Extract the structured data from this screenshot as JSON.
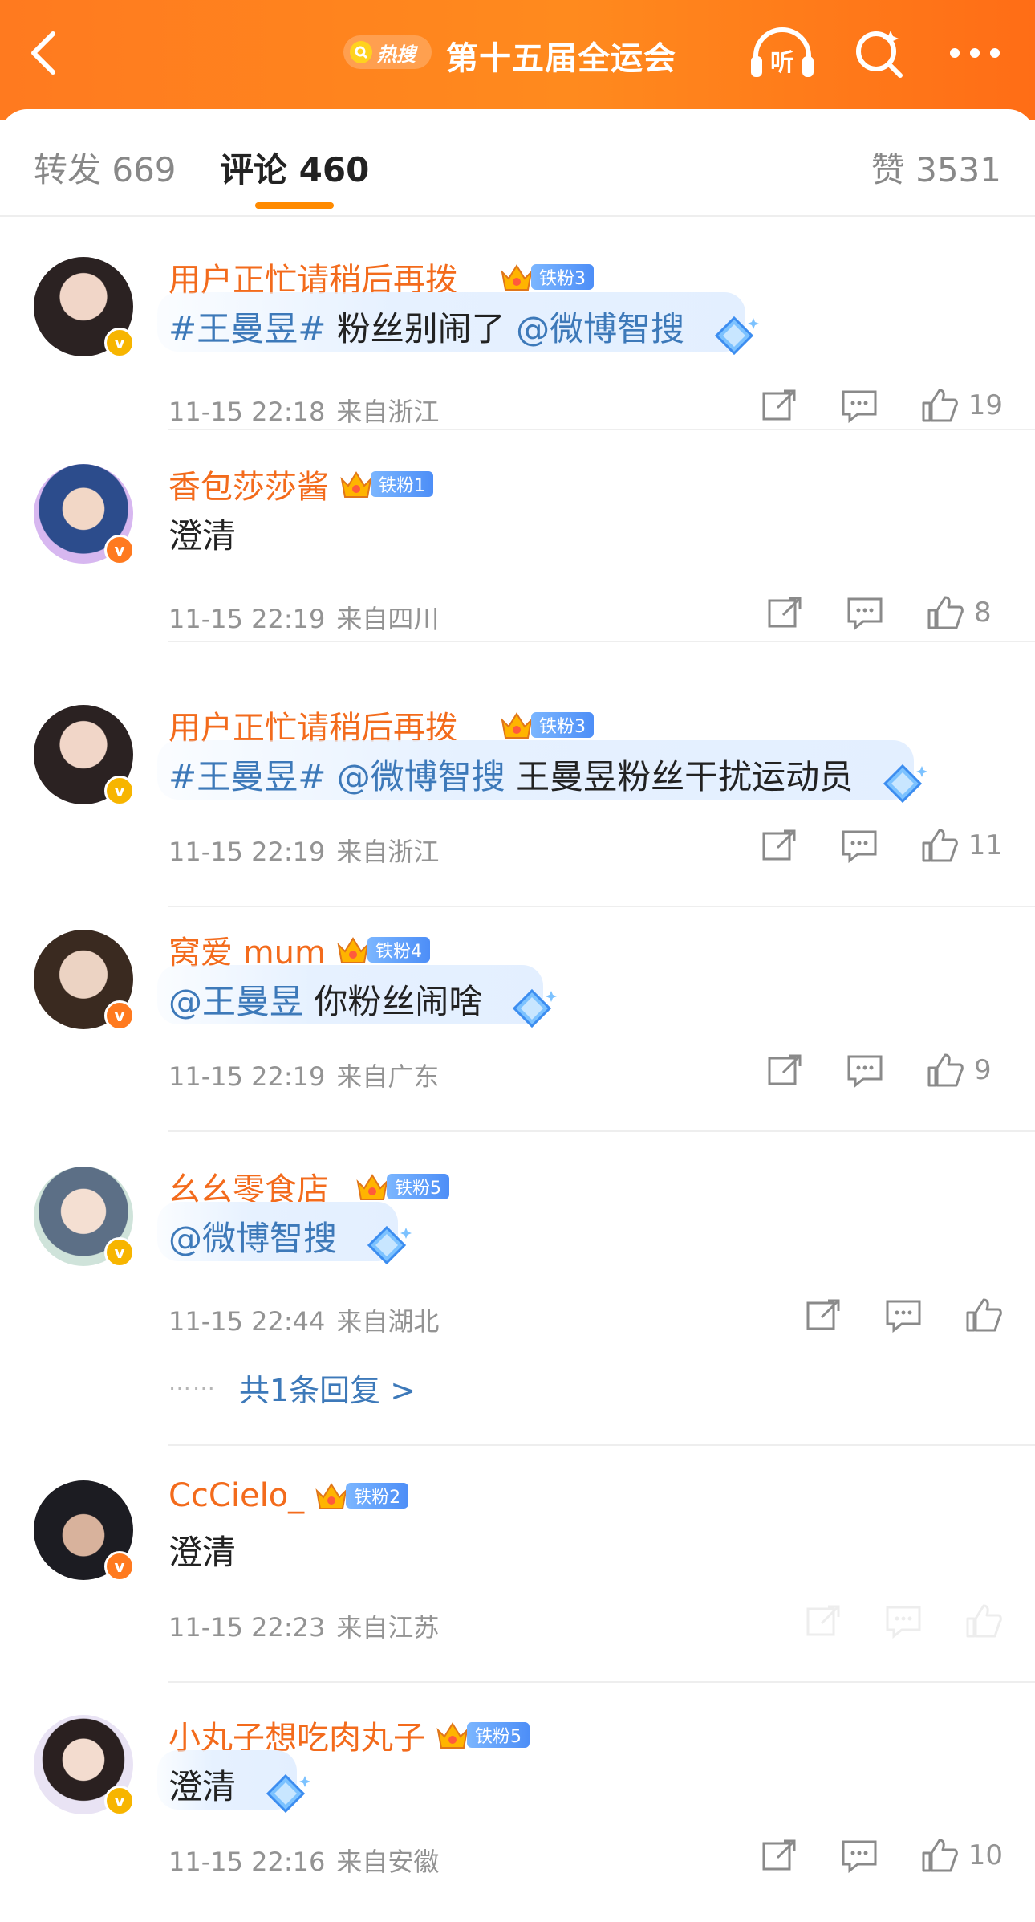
{
  "header": {
    "hot_badge": "热搜",
    "title": "第十五届全运会",
    "listen_label": "听",
    "colors": {
      "bar": "#ff7a1f",
      "accent": "#ff8a00",
      "username": "#f36b1c",
      "link": "#3d79b9"
    }
  },
  "tabs": {
    "repost": "转发 669",
    "comments": "评论 460",
    "likes": "赞 3531"
  },
  "comments": [
    {
      "user": "用户正忙请稍后再拨__",
      "fan": "铁粉3",
      "badge": "yellow",
      "parts": [
        {
          "t": "#王曼昱#",
          "link": true
        },
        {
          "t": " 粉丝别闹了 ",
          "link": false
        },
        {
          "t": "@微博智搜",
          "link": true
        }
      ],
      "time": "11-15 22:18",
      "location": "来自浙江",
      "likes": "19"
    },
    {
      "user": "香包莎莎酱",
      "fan": "铁粉1",
      "badge": "orange",
      "parts": [
        {
          "t": "澄清",
          "link": false
        }
      ],
      "time": "11-15 22:19",
      "location": "来自四川",
      "likes": "8"
    },
    {
      "user": "用户正忙请稍后再拨__",
      "fan": "铁粉3",
      "badge": "yellow",
      "parts": [
        {
          "t": "#王曼昱#",
          "link": true
        },
        {
          "t": " ",
          "link": false
        },
        {
          "t": "@微博智搜",
          "link": true
        },
        {
          "t": " 王曼昱粉丝干扰运动员",
          "link": false
        }
      ],
      "time": "11-15 22:19",
      "location": "来自浙江",
      "likes": "11"
    },
    {
      "user": "窝爱 mum",
      "fan": "铁粉4",
      "badge": "orange",
      "parts": [
        {
          "t": "@王曼昱",
          "link": true
        },
        {
          "t": " 你粉丝闹啥",
          "link": false
        }
      ],
      "time": "11-15 22:19",
      "location": "来自广东",
      "likes": "9"
    },
    {
      "user": "幺幺零食店_",
      "fan": "铁粉5",
      "badge": "yellow",
      "parts": [
        {
          "t": "@微博智搜",
          "link": true
        }
      ],
      "time": "11-15 22:44",
      "location": "来自湖北",
      "likes": "",
      "reply": "共1条回复 >"
    },
    {
      "user": "CcCielo_",
      "fan": "铁粉2",
      "badge": "orange",
      "parts": [
        {
          "t": "澄清",
          "link": false
        }
      ],
      "time": "11-15 22:23",
      "location": "来自江苏",
      "likes": ""
    },
    {
      "user": "小丸子想吃肉丸子",
      "fan": "铁粉5",
      "badge": "yellow",
      "parts": [
        {
          "t": "澄清",
          "link": false
        }
      ],
      "time": "11-15 22:16",
      "location": "来自安徽",
      "likes": "10"
    }
  ]
}
